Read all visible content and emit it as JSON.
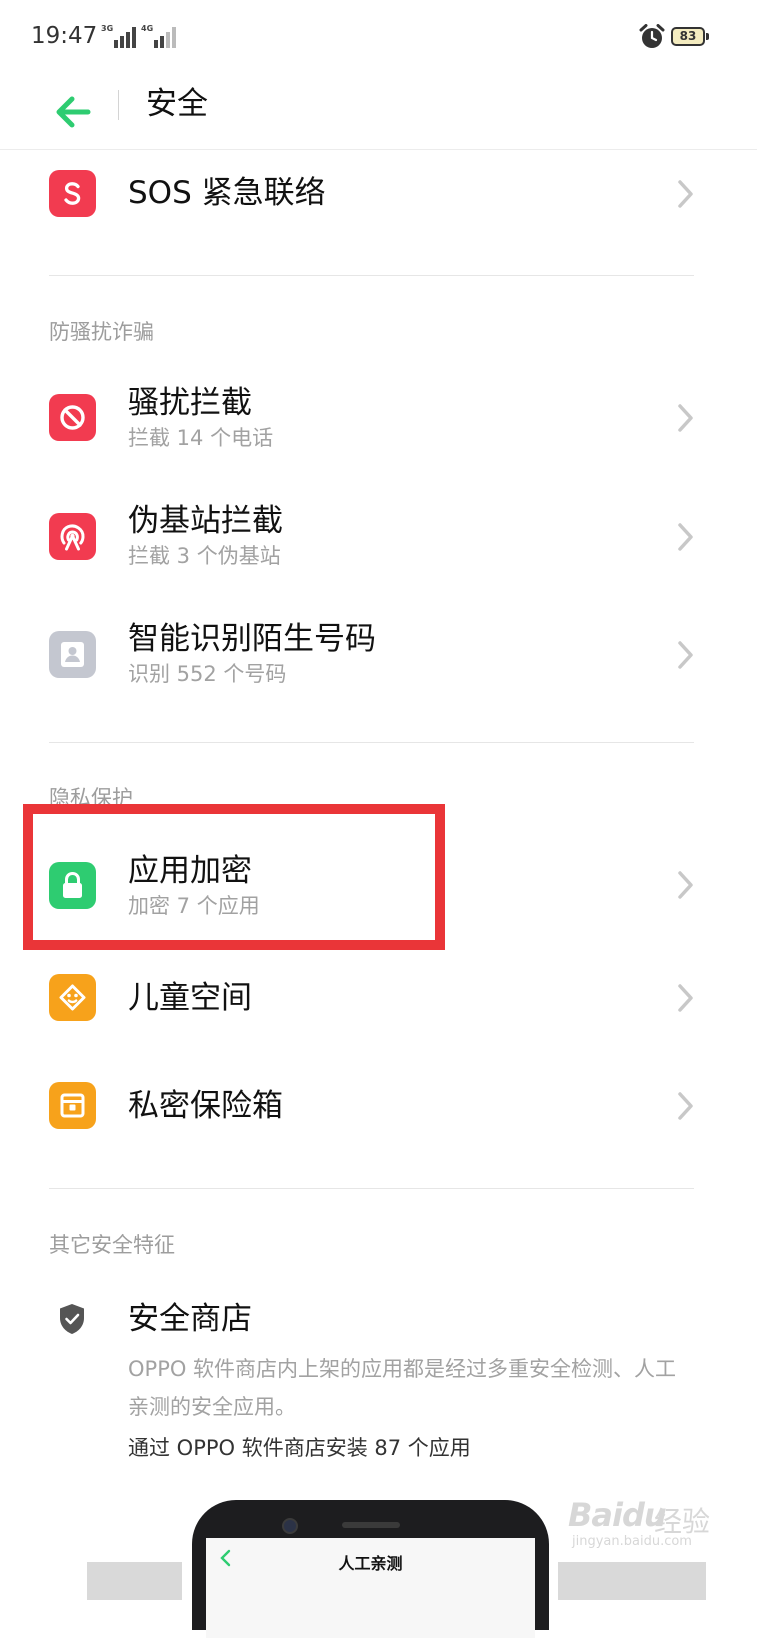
{
  "status_bar": {
    "time": "19:47",
    "network_1": "3G",
    "network_2": "4G",
    "battery": "83",
    "alarm_icon": "alarm-clock-icon"
  },
  "header": {
    "title": "安全",
    "back_icon": "arrow-left-icon",
    "accent_color": "#2ecc71"
  },
  "sos": {
    "title": "SOS 紧急联络",
    "icon": "sos-icon",
    "icon_color": "#f23b50"
  },
  "sections": {
    "anti_fraud": "防骚扰诈骗",
    "privacy": "隐私保护",
    "other": "其它安全特征"
  },
  "anti_fraud_items": [
    {
      "title": "骚扰拦截",
      "subtitle": "拦截 14 个电话",
      "icon": "block-icon",
      "icon_color": "#f23b50"
    },
    {
      "title": "伪基站拦截",
      "subtitle": "拦截 3 个伪基站",
      "icon": "signal-tower-icon",
      "icon_color": "#f23b50"
    },
    {
      "title": "智能识别陌生号码",
      "subtitle": "识别 552 个号码",
      "icon": "contact-card-icon",
      "icon_color": "#c4c7d0"
    }
  ],
  "privacy_items": [
    {
      "title": "应用加密",
      "subtitle": "加密 7 个应用",
      "icon": "lock-icon",
      "icon_color": "#2ecc71"
    },
    {
      "title": "儿童空间",
      "subtitle": "",
      "icon": "child-face-icon",
      "icon_color": "#f7a21b"
    },
    {
      "title": "私密保险箱",
      "subtitle": "",
      "icon": "safe-box-icon",
      "icon_color": "#f7a21b"
    }
  ],
  "store": {
    "title": "安全商店",
    "icon": "shield-check-icon",
    "description": "OPPO 软件商店内上架的应用都是经过多重安全检测、人工亲测的安全应用。",
    "install_text": "通过 OPPO 软件商店安装 87 个应用"
  },
  "phone_preview": {
    "title": "人工亲测"
  },
  "watermark": {
    "brand": "Baidu",
    "brand_cn": "经验",
    "url": "jingyan.baidu.com"
  },
  "highlight_color": "#ea3538"
}
